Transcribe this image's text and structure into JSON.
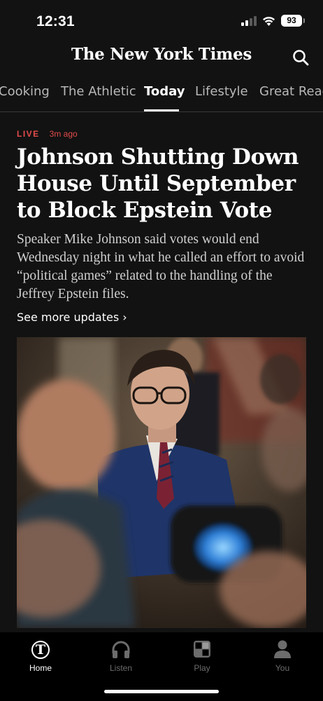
{
  "status_bar": {
    "time": "12:31",
    "battery": "93",
    "icons": [
      "signal-icon",
      "wifi-icon",
      "battery-icon"
    ]
  },
  "masthead": {
    "logo": "The New York Times",
    "search_icon": "search-icon"
  },
  "tabs": [
    {
      "label": "Cooking"
    },
    {
      "label": "The Athletic"
    },
    {
      "label": "Today",
      "active": true
    },
    {
      "label": "Lifestyle"
    },
    {
      "label": "Great Read"
    }
  ],
  "article": {
    "live_label": "LIVE",
    "time_ago": "3m ago",
    "headline": "Johnson Shutting Down House Until September to Block Epstein Vote",
    "summary": "Speaker Mike Johnson said votes would end Wednesday night in what he called an effort to avoid “political games” related to the handling of the Jeffrey Epstein files.",
    "see_more": "See more updates ›",
    "image_description": "Photo of Mike Johnson surrounded by reporters and cameras"
  },
  "bottom_nav": [
    {
      "label": "Home",
      "icon": "nyt-t-icon",
      "active": true
    },
    {
      "label": "Listen",
      "icon": "headphones-icon"
    },
    {
      "label": "Play",
      "icon": "puzzle-icon"
    },
    {
      "label": "You",
      "icon": "person-icon"
    }
  ],
  "colors": {
    "background": "#121212",
    "live_red": "#e34b4b",
    "text": "#ffffff",
    "muted": "#6c6c6c"
  }
}
